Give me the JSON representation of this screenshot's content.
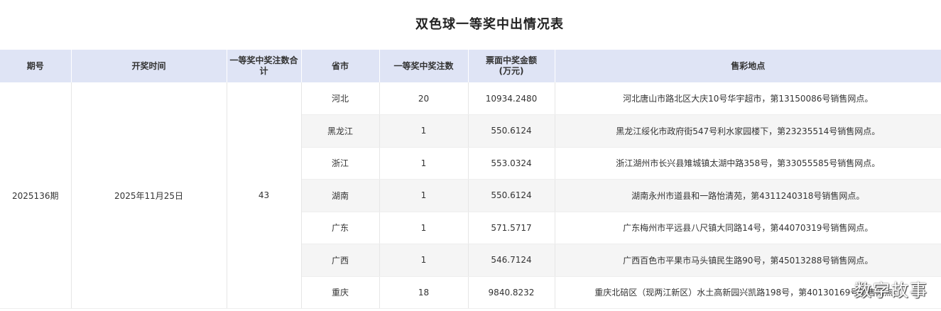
{
  "title": "双色球一等奖中出情况表",
  "headers": {
    "issue": "期号",
    "draw_time": "开奖时间",
    "total_winners": "一等奖中奖注数合计",
    "province": "省市",
    "winners": "一等奖中奖注数",
    "amount_line1": "票面中奖金额",
    "amount_line2": "(万元)",
    "location": "售彩地点"
  },
  "summary": {
    "issue": "2025136期",
    "draw_time": "2025年11月25日",
    "total_winners": "43"
  },
  "rows": [
    {
      "province": "河北",
      "winners": "20",
      "amount": "10934.2480",
      "location": "河北唐山市路北区大庆10号华宇超市，第13150086号销售网点。"
    },
    {
      "province": "黑龙江",
      "winners": "1",
      "amount": "550.6124",
      "location": "黑龙江绥化市政府街547号利水家园楼下，第23235514号销售网点。"
    },
    {
      "province": "浙江",
      "winners": "1",
      "amount": "553.0324",
      "location": "浙江湖州市长兴县雉城镇太湖中路358号，第33055585号销售网点。"
    },
    {
      "province": "湖南",
      "winners": "1",
      "amount": "550.6124",
      "location": "湖南永州市道县和一路怡清苑，第4311240318号销售网点。"
    },
    {
      "province": "广东",
      "winners": "1",
      "amount": "571.5717",
      "location": "广东梅州市平远县八尺镇大同路14号，第44070319号销售网点。"
    },
    {
      "province": "广西",
      "winners": "1",
      "amount": "546.7124",
      "location": "广西百色市平果市马头镇民生路90号，第45013288号销售网点。"
    },
    {
      "province": "重庆",
      "winners": "18",
      "amount": "9840.8232",
      "location": "重庆北碚区（现两江新区）水土高新园兴凯路198号，第40130169号销售网点。"
    }
  ],
  "watermark": "数字故事"
}
